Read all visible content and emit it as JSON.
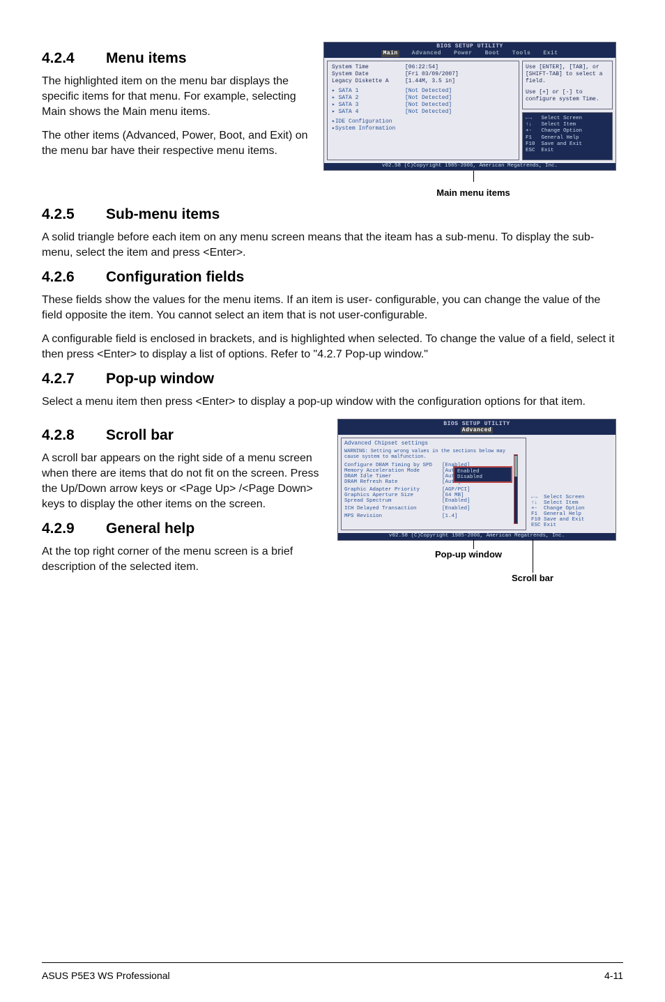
{
  "s424": {
    "num": "4.2.4",
    "title": "Menu items",
    "p1": "The highlighted item on the menu bar displays the specific items for that menu. For example, selecting Main shows the Main menu items.",
    "p2": "The other items (Advanced, Power, Boot, and Exit) on the menu bar have their respective menu items."
  },
  "fig1": {
    "title": "BIOS SETUP UTILITY",
    "menu": {
      "main": "Main",
      "adv": "Advanced",
      "power": "Power",
      "boot": "Boot",
      "tools": "Tools",
      "exit": "Exit"
    },
    "rows": {
      "time_l": "System Time",
      "time_v": "[06:22:54]",
      "date_l": "System Date",
      "date_v": "[Fri 03/09/2007]",
      "leg_l": "Legacy Diskette A",
      "leg_v": "[1.44M, 3.5 in]",
      "s1_l": "SATA 1",
      "s1_v": "[Not Detected]",
      "s2_l": "SATA 2",
      "s2_v": "[Not Detected]",
      "s3_l": "SATA 3",
      "s3_v": "[Not Detected]",
      "s4_l": "SATA 4",
      "s4_v": "[Not Detected]",
      "ide": "IDE Configuration",
      "sysinfo": "System Information"
    },
    "help1": "Use [ENTER], [TAB], or [SHIFT-TAB] to select a field.",
    "help2": "Use [+] or [-] to configure system Time.",
    "keys": "←→   Select Screen\n↑↓   Select Item\n+-   Change Option\nF1   General Help\nF10  Save and Exit\nESC  Exit",
    "footer": "v02.58 (C)Copyright 1985-2006, American Megatrends, Inc.",
    "caption": "Main menu items"
  },
  "s425": {
    "num": "4.2.5",
    "title": "Sub-menu items",
    "p1": "A solid triangle before each item on any menu screen means that the iteam has a sub-menu. To display the sub-menu, select the item and press <Enter>."
  },
  "s426": {
    "num": "4.2.6",
    "title": "Configuration fields",
    "p1": "These fields show the values for the menu items. If an item is user- configurable, you can change the value of the field opposite the item. You cannot select an item that is not user-configurable.",
    "p2": "A configurable field is enclosed in brackets, and is highlighted when selected. To change the value of a field, select it then press <Enter> to display a list of options. Refer to \"4.2.7 Pop-up window.\""
  },
  "s427": {
    "num": "4.2.7",
    "title": "Pop-up window",
    "p1": "Select a menu item then press <Enter> to display a pop-up window with the configuration options for that item."
  },
  "s428": {
    "num": "4.2.8",
    "title": "Scroll bar",
    "p1": "A scroll bar appears on the right side of a menu screen when there are items that do not fit on the screen. Press the Up/Down arrow keys or <Page Up> /<Page Down> keys to display the other items on the screen."
  },
  "s429": {
    "num": "4.2.9",
    "title": "General help",
    "p1": "At the top right corner of the menu screen is a brief description of the selected item."
  },
  "fig2": {
    "title": "BIOS SETUP UTILITY",
    "tab": "Advanced",
    "panel_title": "Advanced Chipset settings",
    "warn": "WARNING: Setting wrong values in the sections below may cause system to malfunction.",
    "rows": {
      "r1_l": "Configure DRAM Timing by SPD",
      "r1_v": "[Enabled]",
      "r2_l": "Memory Acceleration Mode",
      "r2_v": "[Auto]",
      "r3_l": "DRAM Idle Timer",
      "r3_v": "[Auto]",
      "r4_l": "DRAM Refresh Rate",
      "r4_v": "[Auto]",
      "r5_l": "Graphic Adapter Priority",
      "r5_v": "[AGP/PCI]",
      "r6_l": "Graphics Aperture Size",
      "r6_v": "[64 MB]",
      "r7_l": "Spread Spectrum",
      "r7_v": "[Enabled]",
      "r8_l": "ICH Delayed Transaction",
      "r8_v": "[Enabled]",
      "r9_l": "MPS Revision",
      "r9_v": "[1.4]"
    },
    "popup_opts": "Enabled\nDisabled",
    "keys": "←→  Select Screen\n↑↓  Select Item\n+-  Change Option\nF1  General Help\nF10 Save and Exit\nESC Exit",
    "footer": "v02.58 (C)Copyright 1985-2006, American Megatrends, Inc.",
    "lbl_popup": "Pop-up window",
    "lbl_scroll": "Scroll bar"
  },
  "footer": {
    "left": "ASUS P5E3 WS Professional",
    "right": "4-11"
  }
}
